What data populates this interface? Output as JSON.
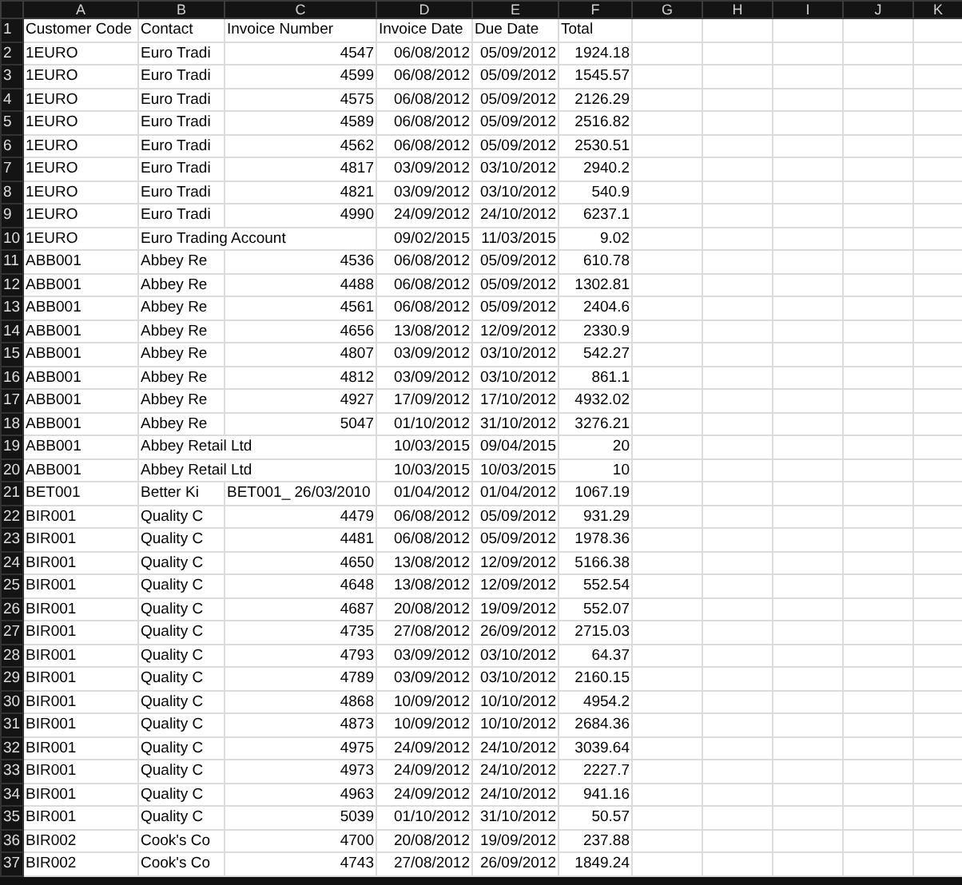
{
  "column_headers": [
    "A",
    "B",
    "C",
    "D",
    "E",
    "F",
    "G",
    "H",
    "I",
    "J",
    "K"
  ],
  "header_row": {
    "number": "1",
    "cells": [
      "Customer Code",
      "Contact",
      "Invoice Number",
      "Invoice Date",
      "Due Date",
      "Total"
    ]
  },
  "rows": [
    {
      "number": "2",
      "customer_code": "1EURO",
      "contact": "Euro Tradi",
      "invoice_number": "4547",
      "invoice_date": "06/08/2012",
      "due_date": "05/09/2012",
      "total": "1924.18"
    },
    {
      "number": "3",
      "customer_code": "1EURO",
      "contact": "Euro Tradi",
      "invoice_number": "4599",
      "invoice_date": "06/08/2012",
      "due_date": "05/09/2012",
      "total": "1545.57"
    },
    {
      "number": "4",
      "customer_code": "1EURO",
      "contact": "Euro Tradi",
      "invoice_number": "4575",
      "invoice_date": "06/08/2012",
      "due_date": "05/09/2012",
      "total": "2126.29"
    },
    {
      "number": "5",
      "customer_code": "1EURO",
      "contact": "Euro Tradi",
      "invoice_number": "4589",
      "invoice_date": "06/08/2012",
      "due_date": "05/09/2012",
      "total": "2516.82"
    },
    {
      "number": "6",
      "customer_code": "1EURO",
      "contact": "Euro Tradi",
      "invoice_number": "4562",
      "invoice_date": "06/08/2012",
      "due_date": "05/09/2012",
      "total": "2530.51"
    },
    {
      "number": "7",
      "customer_code": "1EURO",
      "contact": "Euro Tradi",
      "invoice_number": "4817",
      "invoice_date": "03/09/2012",
      "due_date": "03/10/2012",
      "total": "2940.2"
    },
    {
      "number": "8",
      "customer_code": "1EURO",
      "contact": "Euro Tradi",
      "invoice_number": "4821",
      "invoice_date": "03/09/2012",
      "due_date": "03/10/2012",
      "total": "540.9"
    },
    {
      "number": "9",
      "customer_code": "1EURO",
      "contact": "Euro Tradi",
      "invoice_number": "4990",
      "invoice_date": "24/09/2012",
      "due_date": "24/10/2012",
      "total": "6237.1"
    },
    {
      "number": "10",
      "customer_code": "1EURO",
      "contact": "Euro Trading Account",
      "invoice_date": "09/02/2015",
      "due_date": "11/03/2015",
      "total": "9.02"
    },
    {
      "number": "11",
      "customer_code": "ABB001",
      "contact": "Abbey Re",
      "invoice_number": "4536",
      "invoice_date": "06/08/2012",
      "due_date": "05/09/2012",
      "total": "610.78"
    },
    {
      "number": "12",
      "customer_code": "ABB001",
      "contact": "Abbey Re",
      "invoice_number": "4488",
      "invoice_date": "06/08/2012",
      "due_date": "05/09/2012",
      "total": "1302.81"
    },
    {
      "number": "13",
      "customer_code": "ABB001",
      "contact": "Abbey Re",
      "invoice_number": "4561",
      "invoice_date": "06/08/2012",
      "due_date": "05/09/2012",
      "total": "2404.6"
    },
    {
      "number": "14",
      "customer_code": "ABB001",
      "contact": "Abbey Re",
      "invoice_number": "4656",
      "invoice_date": "13/08/2012",
      "due_date": "12/09/2012",
      "total": "2330.9"
    },
    {
      "number": "15",
      "customer_code": "ABB001",
      "contact": "Abbey Re",
      "invoice_number": "4807",
      "invoice_date": "03/09/2012",
      "due_date": "03/10/2012",
      "total": "542.27"
    },
    {
      "number": "16",
      "customer_code": "ABB001",
      "contact": "Abbey Re",
      "invoice_number": "4812",
      "invoice_date": "03/09/2012",
      "due_date": "03/10/2012",
      "total": "861.1"
    },
    {
      "number": "17",
      "customer_code": "ABB001",
      "contact": "Abbey Re",
      "invoice_number": "4927",
      "invoice_date": "17/09/2012",
      "due_date": "17/10/2012",
      "total": "4932.02"
    },
    {
      "number": "18",
      "customer_code": "ABB001",
      "contact": "Abbey Re",
      "invoice_number": "5047",
      "invoice_date": "01/10/2012",
      "due_date": "31/10/2012",
      "total": "3276.21"
    },
    {
      "number": "19",
      "customer_code": "ABB001",
      "contact": "Abbey Retail Ltd",
      "invoice_date": "10/03/2015",
      "due_date": "09/04/2015",
      "total": "20"
    },
    {
      "number": "20",
      "customer_code": "ABB001",
      "contact": "Abbey Retail Ltd",
      "invoice_date": "10/03/2015",
      "due_date": "10/03/2015",
      "total": "10"
    },
    {
      "number": "21",
      "customer_code": "BET001",
      "contact": "Better Ki",
      "invoice_number": "BET001_ 26/03/2010",
      "invoice_date": "01/04/2012",
      "due_date": "01/04/2012",
      "total": "1067.19"
    },
    {
      "number": "22",
      "customer_code": "BIR001",
      "contact": "Quality C",
      "invoice_number": "4479",
      "invoice_date": "06/08/2012",
      "due_date": "05/09/2012",
      "total": "931.29"
    },
    {
      "number": "23",
      "customer_code": "BIR001",
      "contact": "Quality C",
      "invoice_number": "4481",
      "invoice_date": "06/08/2012",
      "due_date": "05/09/2012",
      "total": "1978.36"
    },
    {
      "number": "24",
      "customer_code": "BIR001",
      "contact": "Quality C",
      "invoice_number": "4650",
      "invoice_date": "13/08/2012",
      "due_date": "12/09/2012",
      "total": "5166.38"
    },
    {
      "number": "25",
      "customer_code": "BIR001",
      "contact": "Quality C",
      "invoice_number": "4648",
      "invoice_date": "13/08/2012",
      "due_date": "12/09/2012",
      "total": "552.54"
    },
    {
      "number": "26",
      "customer_code": "BIR001",
      "contact": "Quality C",
      "invoice_number": "4687",
      "invoice_date": "20/08/2012",
      "due_date": "19/09/2012",
      "total": "552.07"
    },
    {
      "number": "27",
      "customer_code": "BIR001",
      "contact": "Quality C",
      "invoice_number": "4735",
      "invoice_date": "27/08/2012",
      "due_date": "26/09/2012",
      "total": "2715.03"
    },
    {
      "number": "28",
      "customer_code": "BIR001",
      "contact": "Quality C",
      "invoice_number": "4793",
      "invoice_date": "03/09/2012",
      "due_date": "03/10/2012",
      "total": "64.37"
    },
    {
      "number": "29",
      "customer_code": "BIR001",
      "contact": "Quality C",
      "invoice_number": "4789",
      "invoice_date": "03/09/2012",
      "due_date": "03/10/2012",
      "total": "2160.15"
    },
    {
      "number": "30",
      "customer_code": "BIR001",
      "contact": "Quality C",
      "invoice_number": "4868",
      "invoice_date": "10/09/2012",
      "due_date": "10/10/2012",
      "total": "4954.2"
    },
    {
      "number": "31",
      "customer_code": "BIR001",
      "contact": "Quality C",
      "invoice_number": "4873",
      "invoice_date": "10/09/2012",
      "due_date": "10/10/2012",
      "total": "2684.36"
    },
    {
      "number": "32",
      "customer_code": "BIR001",
      "contact": "Quality C",
      "invoice_number": "4975",
      "invoice_date": "24/09/2012",
      "due_date": "24/10/2012",
      "total": "3039.64"
    },
    {
      "number": "33",
      "customer_code": "BIR001",
      "contact": "Quality C",
      "invoice_number": "4973",
      "invoice_date": "24/09/2012",
      "due_date": "24/10/2012",
      "total": "2227.7"
    },
    {
      "number": "34",
      "customer_code": "BIR001",
      "contact": "Quality C",
      "invoice_number": "4963",
      "invoice_date": "24/09/2012",
      "due_date": "24/10/2012",
      "total": "941.16"
    },
    {
      "number": "35",
      "customer_code": "BIR001",
      "contact": "Quality C",
      "invoice_number": "5039",
      "invoice_date": "01/10/2012",
      "due_date": "31/10/2012",
      "total": "50.57"
    },
    {
      "number": "36",
      "customer_code": "BIR002",
      "contact": "Cook's Co",
      "invoice_number": "4700",
      "invoice_date": "20/08/2012",
      "due_date": "19/09/2012",
      "total": "237.88"
    },
    {
      "number": "37",
      "customer_code": "BIR002",
      "contact": "Cook's Co",
      "invoice_number": "4743",
      "invoice_date": "27/08/2012",
      "due_date": "26/09/2012",
      "total": "1849.24"
    }
  ]
}
